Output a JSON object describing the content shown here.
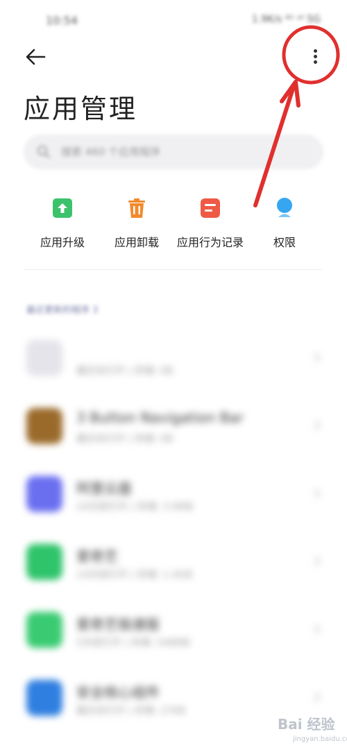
{
  "status_bar": {
    "time": "10:54",
    "right_text": "1.9K/s ⁴ᴳ ᵃˡˡ 5G"
  },
  "nav": {
    "back_icon": "back-arrow-icon",
    "more_icon": "more-vertical-icon"
  },
  "page": {
    "title": "应用管理"
  },
  "search": {
    "placeholder": "搜索 460 个应用程序"
  },
  "quick_actions": [
    {
      "label": "应用升级",
      "icon": "upgrade-icon",
      "color": "#3cc26b"
    },
    {
      "label": "应用卸载",
      "icon": "trash-icon",
      "color": "#f28a2c"
    },
    {
      "label": "应用行为记录",
      "icon": "record-icon",
      "color": "#ef5a45"
    },
    {
      "label": "权限",
      "icon": "permission-icon",
      "color": "#36a6f0"
    }
  ],
  "section": {
    "header": "最近更新的程序 3"
  },
  "apps": [
    {
      "name": "",
      "meta": "最近未打开 | 存储: 0B",
      "icon_color": "#e4e4ea"
    },
    {
      "name": "3 Button Navigation Bar",
      "meta": "最近未打开 | 存储: 0B",
      "icon_color": "#9a6a2a"
    },
    {
      "name": "阿里云盘",
      "meta": "24天前打开 | 存储: 3.9MB",
      "icon_color": "#6a6ff0"
    },
    {
      "name": "爱奇艺",
      "meta": "14天前打开 | 存储: 1.4GB",
      "icon_color": "#2ec46a"
    },
    {
      "name": "爱奇艺极速版",
      "meta": "5天前打开 | 存储: 548MB",
      "icon_color": "#3acb72"
    },
    {
      "name": "安全核心组件",
      "meta": "最近未打开 | 存储: 27KB",
      "icon_color": "#2f7fe0"
    }
  ],
  "annotation": {
    "color": "#e0302e"
  },
  "watermark": {
    "text": "Bai 经验",
    "sub": "jingyan.baidu.com"
  }
}
